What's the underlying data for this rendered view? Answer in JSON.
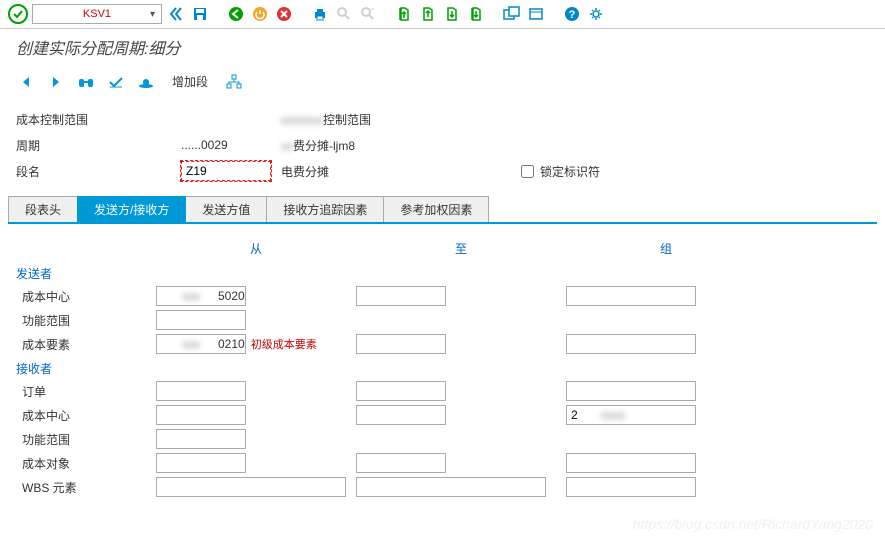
{
  "toolbar": {
    "tcode": "KSV1"
  },
  "page": {
    "title": "创建实际分配周期:细分"
  },
  "subtoolbar": {
    "add_segment": "增加段"
  },
  "header": {
    "cost_ctrl_label": "成本控制范围",
    "cost_ctrl_val": "",
    "cost_ctrl_desc": "控制范围",
    "period_label": "周期",
    "period_val": "......0029",
    "period_desc": "费分摊-ljm8",
    "segname_label": "段名",
    "segname_val": "Z19",
    "segname_desc": "电费分摊",
    "lock_label": "锁定标识符"
  },
  "tabs": {
    "t1": "段表头",
    "t2": "发送方/接收方",
    "t3": "发送方值",
    "t4": "接收方追踪因素",
    "t5": "参考加权因素"
  },
  "cols": {
    "from": "从",
    "to": "至",
    "group": "组"
  },
  "sender": {
    "title": "发送者",
    "cost_center": "成本中心",
    "cost_center_from": "5020",
    "func_area": "功能范围",
    "cost_elem": "成本要素",
    "cost_elem_from": "0210",
    "cost_elem_note": "初级成本要素"
  },
  "receiver": {
    "title": "接收者",
    "order": "订单",
    "cost_center": "成本中心",
    "cost_center_grp": "2",
    "func_area": "功能范围",
    "cost_obj": "成本对象",
    "wbs": "WBS 元素"
  },
  "watermark": "https://blog.csdn.net/RichardYang2020"
}
